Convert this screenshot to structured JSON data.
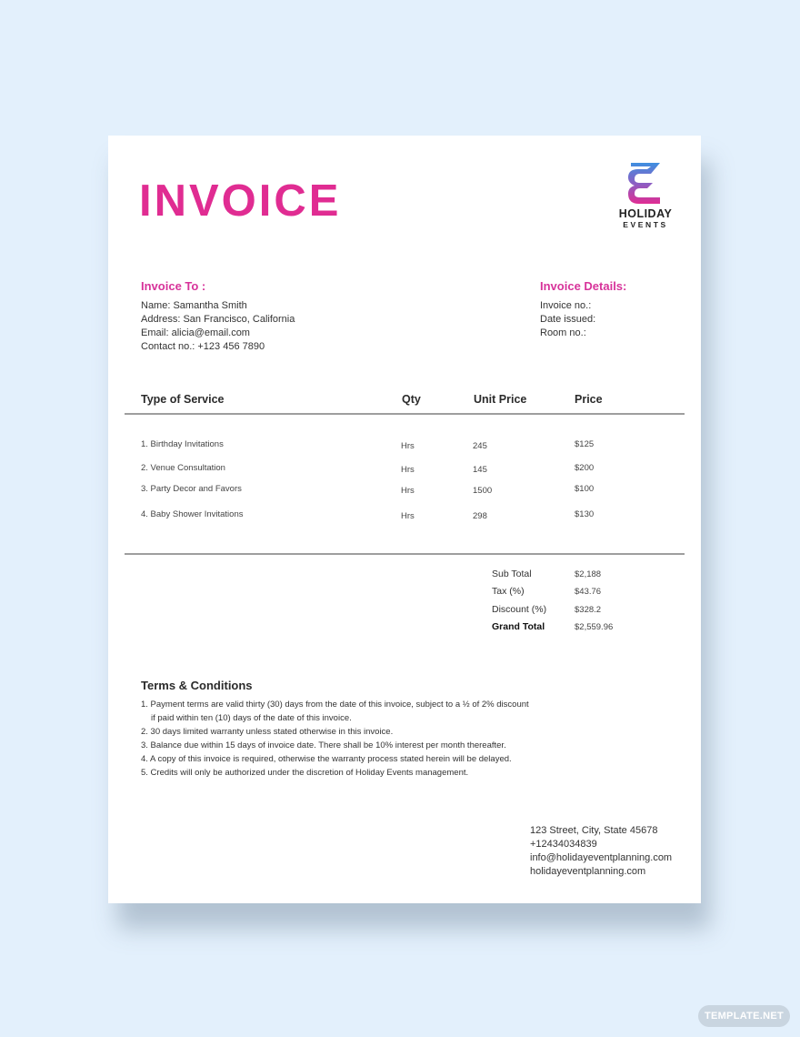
{
  "document": {
    "title": "INVOICE",
    "brand": {
      "logo_icon": "holiday-events-e-logo",
      "line1": "HOLIDAY",
      "line2": "EVENTS",
      "colors": {
        "top": "#3f8fe0",
        "middle": "#8a5fc4",
        "bottom": "#e02c92"
      }
    },
    "accent_color": "#e02c92",
    "invoice_to": {
      "heading": "Invoice To :",
      "lines": [
        "Name: Samantha Smith",
        "Address: San Francisco, California",
        "Email: alicia@email.com",
        "Contact no.: +123 456 7890"
      ]
    },
    "invoice_details": {
      "heading": "Invoice Details:",
      "lines": [
        "Invoice no.:",
        "Date issued:",
        "Room no.:"
      ]
    },
    "table": {
      "headers": [
        "Type of Service",
        "Qty",
        "Unit Price",
        "Price"
      ],
      "rows": [
        {
          "service": "1. Birthday Invitations",
          "qty": "Hrs",
          "unit_price": "245",
          "price": "$125"
        },
        {
          "service": "2. Venue Consultation",
          "qty": "Hrs",
          "unit_price": "145",
          "price": "$200"
        },
        {
          "service": "3. Party Decor and Favors",
          "qty": "Hrs",
          "unit_price": "1500",
          "price": "$100"
        },
        {
          "service": "4. Baby Shower Invitations",
          "qty": "Hrs",
          "unit_price": "298",
          "price": "$130"
        }
      ]
    },
    "totals": [
      {
        "label": "Sub Total",
        "value": "$2,188"
      },
      {
        "label": "Tax (%)",
        "value": "$43.76"
      },
      {
        "label": "Discount (%)",
        "value": "$328.2"
      },
      {
        "label": "Grand Total",
        "value": "$2,559.96"
      }
    ],
    "terms": {
      "heading": "Terms & Conditions",
      "lines": [
        "1. Payment terms are valid thirty (30) days from the date of this invoice, subject to a ½ of 2% discount",
        "if paid within ten (10) days of the date of this invoice.",
        "2. 30 days limited warranty unless stated otherwise in this invoice.",
        "3. Balance due within  15 days of invoice date. There shall be 10% interest per month thereafter.",
        "4. A copy of this invoice is required, otherwise the warranty process stated herein will be delayed.",
        "5. Credits will only be authorized under the discretion of Holiday Events management."
      ]
    },
    "footer": {
      "address": "123 Street, City, State 45678",
      "phone": "+12434034839",
      "email": "info@holidayeventplanning.com",
      "website": "holidayeventplanning.com"
    }
  },
  "watermark": {
    "label": "TEMPLATE.NET"
  }
}
